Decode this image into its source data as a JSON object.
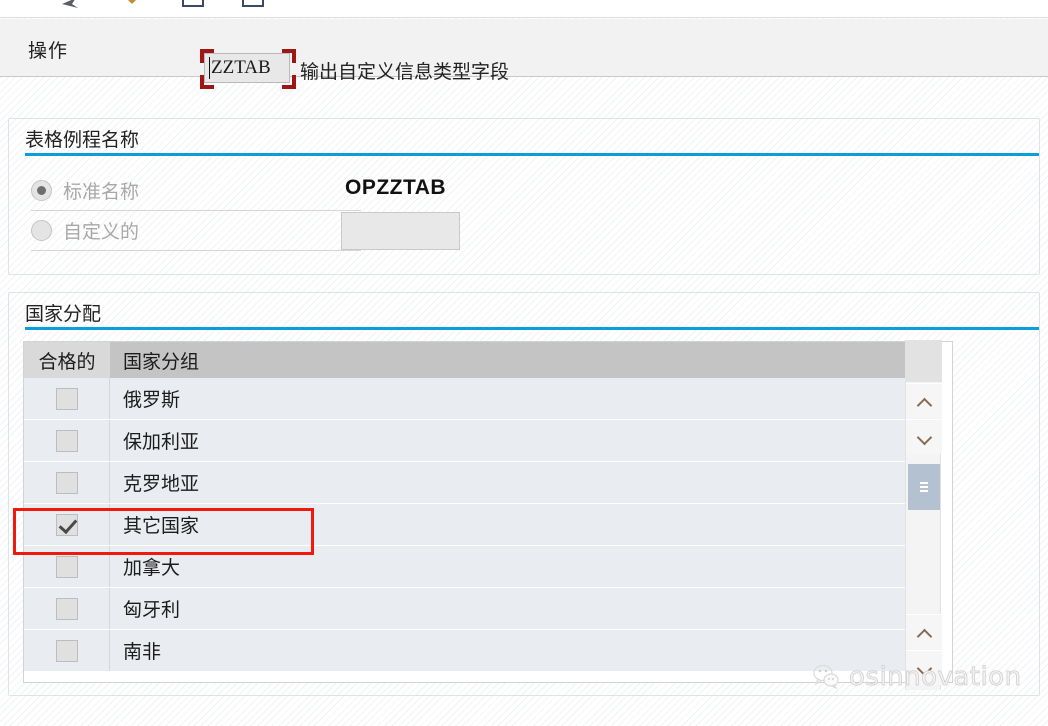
{
  "toolbar": {
    "icons": [
      "back-arrow-icon",
      "forward-arrow-icon",
      "document-icon",
      "document-blue-icon"
    ]
  },
  "operation_bar": {
    "label": "操作",
    "input_value": "ZZTAB",
    "description": "输出自定义信息类型字段",
    "annotation_color": "#9e1616"
  },
  "name_panel": {
    "title": "表格例程名称",
    "rule_color": "#0a9fdc",
    "options": [
      {
        "label": "标准名称",
        "selected": true
      },
      {
        "label": "自定义的",
        "selected": false
      }
    ],
    "standard_value": "OPZZTAB",
    "custom_value": ""
  },
  "country_panel": {
    "title": "国家分配",
    "rule_color": "#0a9fdc",
    "columns": [
      "合格的",
      "国家分组"
    ],
    "rows": [
      {
        "name": "俄罗斯",
        "checked": false
      },
      {
        "name": "保加利亚",
        "checked": false
      },
      {
        "name": "克罗地亚",
        "checked": false
      },
      {
        "name": "其它国家",
        "checked": true
      },
      {
        "name": "加拿大",
        "checked": false
      },
      {
        "name": "匈牙利",
        "checked": false
      },
      {
        "name": "南非",
        "checked": false
      }
    ],
    "highlight_row": "其它国家",
    "highlight_color": "#ef1a0d"
  },
  "scrollbar": {
    "up_icon": "chevron-up-icon",
    "down_icon": "chevron-down-icon",
    "thumb_color": "#b4c1d0"
  },
  "watermark": {
    "text": "osinnovation",
    "logo": "wechat-logo-icon"
  }
}
